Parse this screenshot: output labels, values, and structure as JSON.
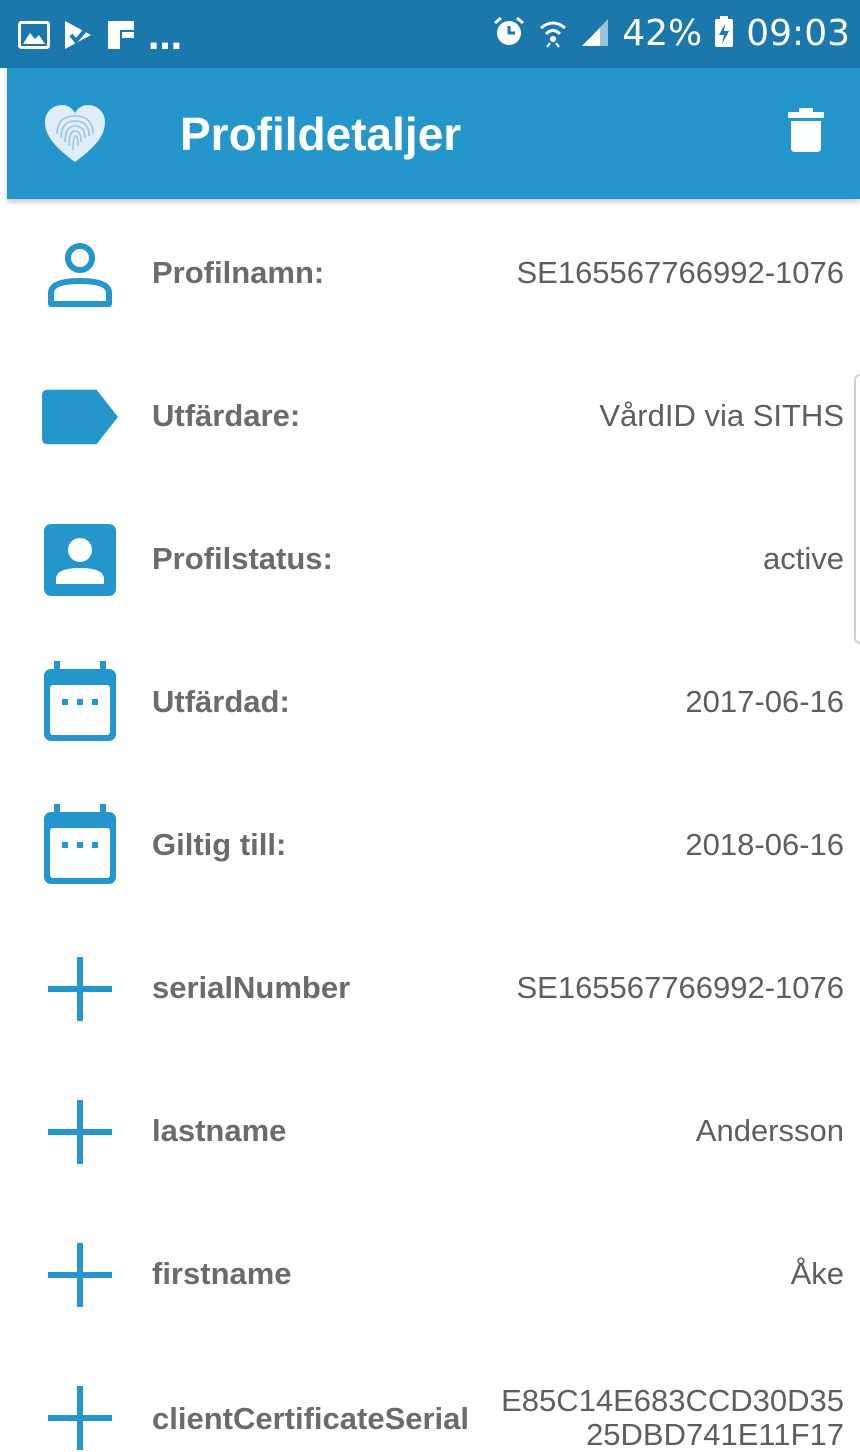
{
  "status_bar": {
    "notification_icons": [
      "image-icon",
      "check-icon",
      "app-icon"
    ],
    "overflow": "…",
    "battery": "42%",
    "time": "09:03",
    "system_icons": [
      "alarm-icon",
      "wifi-icon",
      "signal-icon",
      "battery-icon"
    ]
  },
  "app_bar": {
    "title": "Profildetaljer",
    "logo_icon": "fingerprint-heart-icon",
    "action_icon": "delete-icon",
    "color": "#2596cc"
  },
  "rows": [
    {
      "label": "Profilnamn:",
      "value": "SE165567766992-1076",
      "icon": "person-outline-icon"
    },
    {
      "label": "Utfärdare:",
      "value": "VårdID via SITHS",
      "icon": "label-tag-icon"
    },
    {
      "label": "Profilstatus:",
      "value": "active",
      "icon": "account-box-icon"
    },
    {
      "label": "Utfärdad:",
      "value": "2017-06-16",
      "icon": "calendar-icon"
    },
    {
      "label": "Giltig till:",
      "value": "2018-06-16",
      "icon": "calendar-icon"
    },
    {
      "label": "serialNumber",
      "value": "SE165567766992-1076",
      "icon": "plus-icon"
    },
    {
      "label": "lastname",
      "value": "Andersson",
      "icon": "plus-icon"
    },
    {
      "label": "firstname",
      "value": "Åke",
      "icon": "plus-icon"
    },
    {
      "label": "clientCertificateSerial",
      "value_lines": [
        "E85C14E683CCD30D35",
        "25DBD741E11F17"
      ],
      "icon": "plus-icon"
    }
  ],
  "colors": {
    "status_bar": "#1b78ad",
    "accent": "#2596cc",
    "label_text": "#6b6b6b",
    "value_text": "#5e5e5e"
  }
}
